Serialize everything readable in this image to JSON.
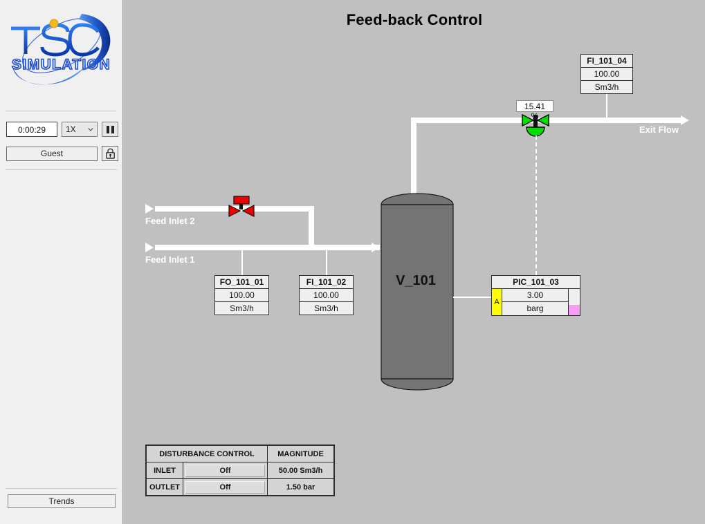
{
  "app": {
    "brand_primary": "#1b4fd8",
    "brand_accent": "#f5b820",
    "logo_main": "TSC",
    "logo_sub": "SIMULATION"
  },
  "sidebar": {
    "timer": "0:00:29",
    "speed": "1X",
    "speed_options": [
      "1X"
    ],
    "pause_label": "",
    "user": "Guest",
    "lock_icon": "padlock-icon",
    "trends_label": "Trends"
  },
  "header": {
    "title": "Feed-back Control"
  },
  "diagram": {
    "vessel_label": "V_101",
    "feed_inlet_2": "Feed Inlet 2",
    "feed_inlet_1": "Feed Inlet 1",
    "exit_flow": "Exit Flow",
    "control_valve_percent": "15.41 %",
    "inlet_valve_state": "closed-red",
    "control_valve_state": "open-green"
  },
  "tags": {
    "fi_101_04": {
      "name": "FI_101_04",
      "value": "100.00",
      "unit": "Sm3/h"
    },
    "fo_101_01": {
      "name": "FO_101_01",
      "value": "100.00",
      "unit": "Sm3/h"
    },
    "fi_101_02": {
      "name": "FI_101_02",
      "value": "100.00",
      "unit": "Sm3/h"
    },
    "pic_101_03": {
      "name": "PIC_101_03",
      "alarm": "A",
      "value": "3.00",
      "unit": "barg"
    }
  },
  "disturbance": {
    "header_left": "DISTURBANCE CONTROL",
    "header_right": "MAGNITUDE",
    "rows": [
      {
        "label": "INLET",
        "state": "Off",
        "magnitude": "50.00 Sm3/h"
      },
      {
        "label": "OUTLET",
        "state": "Off",
        "magnitude": "1.50 bar"
      }
    ]
  }
}
